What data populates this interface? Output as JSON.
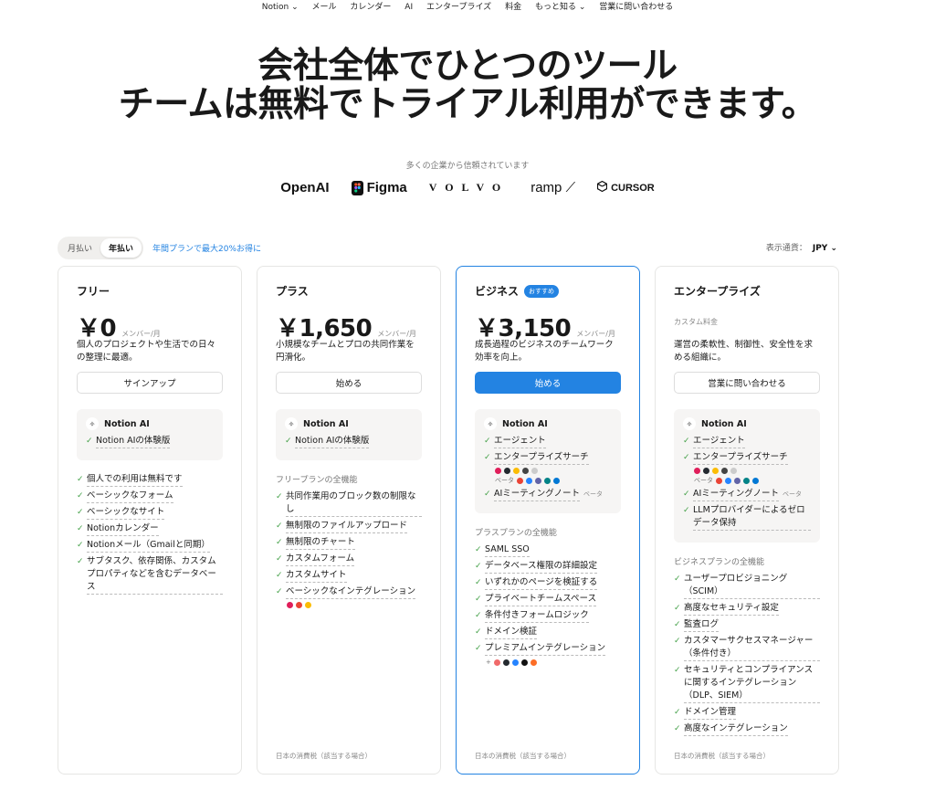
{
  "nav": [
    "Notion ⌄",
    "メール",
    "カレンダー",
    "AI",
    "エンタープライズ",
    "料金",
    "もっと知る ⌄",
    "営業に問い合わせる"
  ],
  "hero": {
    "line1": "会社全体でひとつのツール",
    "line2": "チームは無料でトライアル利用ができます。"
  },
  "trust": "多くの企業から信頼されています",
  "logos": {
    "openai": "OpenAI",
    "figma": "Figma",
    "volvo": "VOLVO",
    "ramp": "ramp",
    "cursor": "CURSOR"
  },
  "billing": {
    "monthly": "月払い",
    "yearly": "年払い",
    "promo": "年間プランで最大20%お得に",
    "currency_label": "表示通貨：",
    "currency": "JPY ⌄"
  },
  "plans": [
    {
      "name": "フリー",
      "price": "￥0",
      "per": "メンバー/月",
      "desc": "個人のプロジェクトや生活での日々の整理に最適。",
      "button": "サインアップ",
      "ai_title": "Notion AI",
      "ai_items": [
        "Notion AIの体験版"
      ],
      "features": [
        "個人での利用は無料です",
        "ベーシックなフォーム",
        "ベーシックなサイト",
        "Notionカレンダー",
        "Notionメール（Gmailと同期）",
        "サブタスク、依存関係、カスタムプロパティなどを含むデータベース"
      ]
    },
    {
      "name": "プラス",
      "price": "￥1,650",
      "per": "メンバー/月",
      "desc": "小規模なチームとプロの共同作業を円滑化。",
      "button": "始める",
      "ai_title": "Notion AI",
      "ai_items": [
        "Notion AIの体験版"
      ],
      "section": "フリープランの全機能",
      "features": [
        "共同作業用のブロック数の制限なし",
        "無制限のファイルアップロード",
        "無制限のチャート",
        "カスタムフォーム",
        "カスタムサイト",
        "ベーシックなインテグレーション"
      ],
      "tax": "日本の消費税（該当する場合）"
    },
    {
      "name": "ビジネス",
      "badge": "おすすめ",
      "price": "￥3,150",
      "per": "メンバー/月",
      "desc": "成長過程のビジネスのチームワーク効率を向上。",
      "button": "始める",
      "ai_title": "Notion AI",
      "ai_items": [
        "エージェント",
        "エンタープライズサーチ",
        "AIミーティングノート"
      ],
      "beta": "ベータ",
      "section": "プラスプランの全機能",
      "features": [
        "SAML SSO",
        "データベース権限の詳細設定",
        "いずれかのページを検証する",
        "プライベートチームスペース",
        "条件付きフォームロジック",
        "ドメイン検証",
        "プレミアムインテグレーション"
      ],
      "tax": "日本の消費税（該当する場合）"
    },
    {
      "name": "エンタープライズ",
      "custom": "カスタム料金",
      "desc": "運営の柔軟性、制御性、安全性を求める組織に。",
      "button": "営業に問い合わせる",
      "ai_title": "Notion AI",
      "ai_items": [
        "エージェント",
        "エンタープライズサーチ",
        "AIミーティングノート",
        "LLMプロバイダーによるゼロデータ保持"
      ],
      "beta": "ベータ",
      "section": "ビジネスプランの全機能",
      "features": [
        "ユーザープロビジョニング（SCIM）",
        "高度なセキュリティ設定",
        "監査ログ",
        "カスタマーサクセスマネージャー（条件付き）",
        "セキュリティとコンプライアンスに関するインテグレーション（DLP、SIEM）",
        "ドメイン管理",
        "高度なインテグレーション"
      ],
      "tax": "日本の消費税（該当する場合）"
    }
  ]
}
